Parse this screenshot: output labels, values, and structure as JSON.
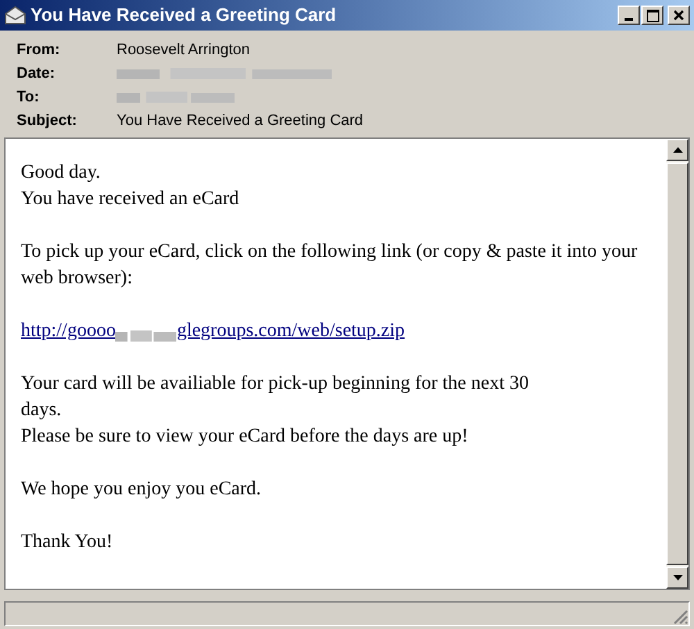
{
  "window": {
    "title": "You Have Received a Greeting Card"
  },
  "header": [
    {
      "label": "From:",
      "value": "Roosevelt Arrington",
      "redacted": false
    },
    {
      "label": "Date:",
      "redacted": true
    },
    {
      "label": "To:",
      "redacted": true
    },
    {
      "label": "Subject:",
      "value": "You Have Received a Greeting Card",
      "redacted": false
    }
  ],
  "body": [
    {
      "kind": "text",
      "lines": [
        "Good day.",
        "You have received an eCard"
      ]
    },
    {
      "kind": "text",
      "lines": [
        "To pick up your eCard, click on the following link (or copy & paste it into your web browser):"
      ]
    },
    {
      "kind": "link",
      "before": "http://goooo",
      "after": "glegroups.com/web/setup.zip"
    },
    {
      "kind": "text",
      "lines": [
        "Your card will be availiable for pick-up beginning for the next 30",
        "days.",
        "Please be sure to view your eCard before the days are up!"
      ]
    },
    {
      "kind": "text",
      "lines": [
        "We hope you enjoy you eCard."
      ]
    },
    {
      "kind": "text",
      "lines": [
        "Thank You!"
      ]
    }
  ]
}
